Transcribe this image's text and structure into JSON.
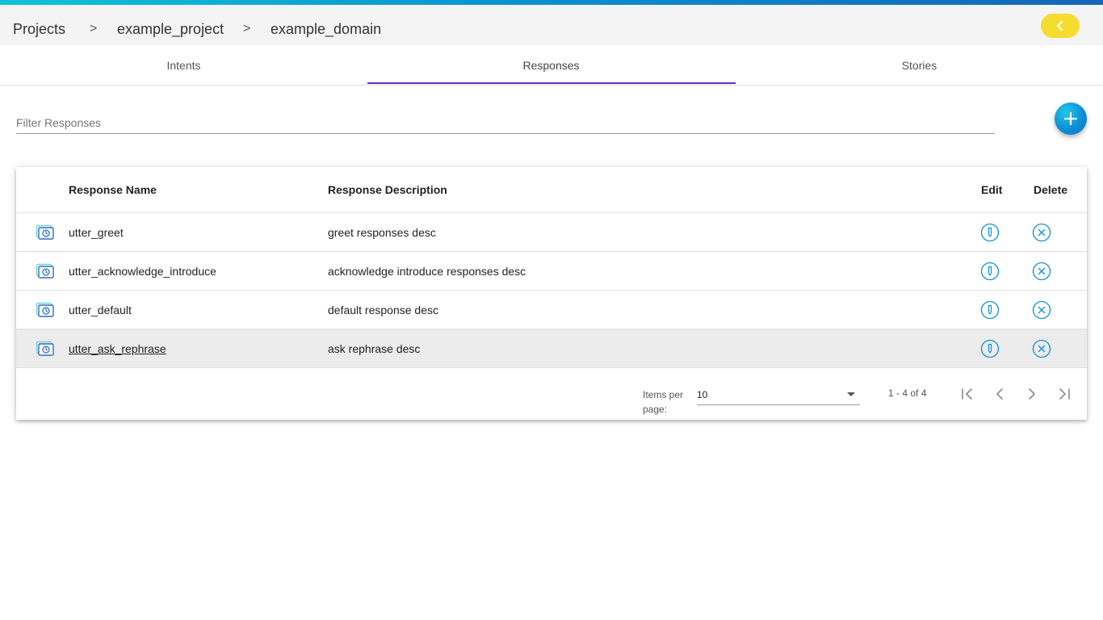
{
  "breadcrumb": {
    "items": [
      "Projects",
      "example_project",
      "example_domain"
    ],
    "separator": ">"
  },
  "header": {
    "back_icon": "chevron-left-icon",
    "back_color": "#f5dd2f"
  },
  "tabs": [
    {
      "label": "Intents",
      "active": false
    },
    {
      "label": "Responses",
      "active": true
    },
    {
      "label": "Stories",
      "active": false
    }
  ],
  "filter": {
    "placeholder": "Filter Responses",
    "value": ""
  },
  "add_button": {
    "icon": "plus-icon"
  },
  "table": {
    "headers": {
      "name": "Response Name",
      "description": "Response Description",
      "edit": "Edit",
      "delete": "Delete"
    },
    "rows": [
      {
        "name": "utter_greet",
        "description": "greet responses desc"
      },
      {
        "name": "utter_acknowledge_introduce",
        "description": "acknowledge introduce responses desc"
      },
      {
        "name": "utter_default",
        "description": "default response desc"
      },
      {
        "name": "utter_ask_rephrase",
        "description": "ask rephrase desc"
      }
    ],
    "row_icon": "response-icon",
    "edit_icon": "edit-icon",
    "delete_icon": "delete-icon"
  },
  "paginator": {
    "items_per_page_label": "Items per page:",
    "items_per_page": "10",
    "range_label": "1 - 4 of 4"
  },
  "colors": {
    "accent": "#5b2fb0",
    "icon_blue": "#0c8fd8",
    "fab": "#0c8fd8"
  }
}
